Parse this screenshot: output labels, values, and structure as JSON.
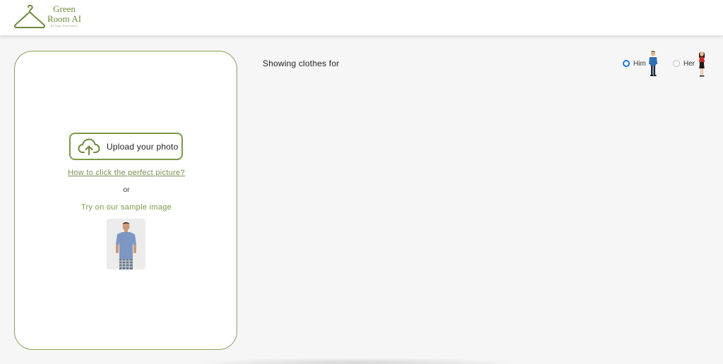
{
  "brand": {
    "line1": "Green",
    "line2": "Room AI",
    "tagline": "Be Your Own Stylist",
    "color": "#6e8b3d"
  },
  "upload_panel": {
    "upload_button_label": "Upload your photo",
    "upload_icon": "cloud-upload-icon",
    "help_link": "How to click the perfect picture?",
    "or_text": "or",
    "sample_label": "Try on our sample image",
    "border_color": "#8aa25a"
  },
  "main": {
    "showing_label": "Showing clothes for",
    "gender_options": [
      {
        "label": "Him",
        "selected": true,
        "icon": "man-figure-icon"
      },
      {
        "label": "Her",
        "selected": false,
        "icon": "woman-figure-icon"
      }
    ],
    "accent_color": "#1a73e8"
  }
}
